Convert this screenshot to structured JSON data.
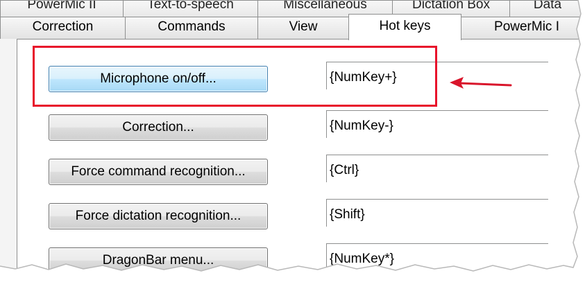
{
  "tabs_back_row": [
    "PowerMic II",
    "Text-to-speech",
    "Miscellaneous",
    "Dictation Box",
    "Data"
  ],
  "tabs_front_row": [
    {
      "label": "Correction",
      "active": false
    },
    {
      "label": "Commands",
      "active": false
    },
    {
      "label": "View",
      "active": false
    },
    {
      "label": "Hot keys",
      "active": true
    },
    {
      "label": "PowerMic I",
      "active": false
    }
  ],
  "hotkeys": [
    {
      "button_label": "Microphone on/off...",
      "key": "{NumKey+}",
      "focused": true
    },
    {
      "button_label": "Correction...",
      "key": "{NumKey-}",
      "focused": false
    },
    {
      "button_label": "Force command recognition...",
      "key": "{Ctrl}",
      "focused": false
    },
    {
      "button_label": "Force dictation recognition...",
      "key": "{Shift}",
      "focused": false
    },
    {
      "button_label": "DragonBar menu...",
      "key": "{NumKey*}",
      "focused": false
    }
  ],
  "annotation": {
    "highlight_color": "#e8102a",
    "arrow_color": "#d9152b"
  }
}
